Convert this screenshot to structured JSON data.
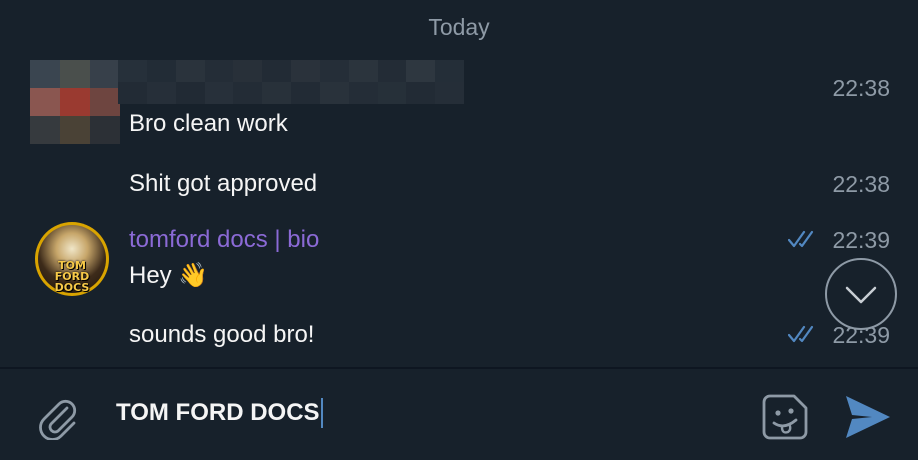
{
  "date_separator": "Today",
  "messages": [
    {
      "text": "Bro clean work",
      "time": "22:38"
    },
    {
      "text": "Shit got approved",
      "time": "22:38"
    },
    {
      "sender": "tomford docs | bio",
      "text": "Hey 👋",
      "time": "22:39",
      "status": "read"
    },
    {
      "text": "sounds good bro!",
      "time": "22:39",
      "status": "read"
    }
  ],
  "avatar_logo": "TOM FORD DOCS",
  "composer": {
    "value": "TOM FORD DOCS"
  },
  "icons": {
    "attach": "paperclip-icon",
    "emoji": "sticker-emoji-icon",
    "send": "send-icon",
    "scroll": "chevron-down-icon",
    "read": "double-check-icon"
  },
  "colors": {
    "background": "#17212b",
    "sender_name": "#8b6ad6",
    "read_ticks": "#5288c1",
    "send_icon": "#5288c1",
    "meta_text": "#8e9aa6"
  }
}
